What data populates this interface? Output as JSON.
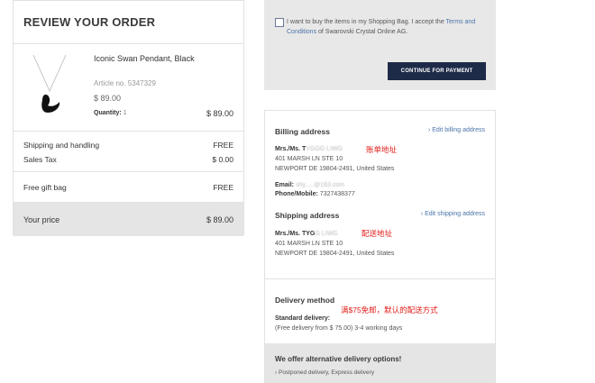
{
  "review": {
    "heading": "REVIEW YOUR ORDER",
    "item": {
      "name": "Iconic Swan Pendant, Black",
      "article": "Article no. 5347329",
      "price": "$ 89.00",
      "qty_label": "Quantity:",
      "qty_value": "1",
      "line_total": "$ 89.00"
    },
    "shipping_label": "Shipping and handling",
    "shipping_value": "FREE",
    "tax_label": "Sales Tax",
    "tax_value": "$ 0.00",
    "gift_label": "Free gift bag",
    "gift_value": "FREE",
    "total_label": "Your price",
    "total_value": "$ 89.00"
  },
  "terms": {
    "text_before": "I want to buy the items in my Shopping Bag. I accept the ",
    "link": "Terms and Conditions",
    "text_after": " of Swarovski Crystal Online AG.",
    "continue_label": "CONTINUE FOR PAYMENT"
  },
  "billing": {
    "heading": "Billing address",
    "edit": "Edit billing address",
    "name_prefix": "Mrs./Ms. T",
    "name_blur": "YGGG LIWG",
    "note": "账单地址",
    "line1": "401 MARSH LN STE 10",
    "line2": "NEWPORT DE 19804-2491, United States",
    "email_label": "Email:",
    "email_blur": "shy.....@163.com",
    "phone_label": "Phone/Mobile:",
    "phone": "7327438377"
  },
  "shipping": {
    "heading": "Shipping address",
    "edit": "Edit shipping address",
    "name_prefix": "Mrs./Ms. TYG",
    "name_blur": "G LIWG",
    "note": "配送地址",
    "line1": "401 MARSH LN STE 10",
    "line2": "NEWPORT DE 19804-2491, United States"
  },
  "delivery": {
    "heading": "Delivery method",
    "note": "满$75免邮，默认的配送方式",
    "method_label": "Standard delivery:",
    "method_desc": "(Free delivery from $ 75.00) 3-4 working days"
  },
  "alternative": {
    "heading": "We offer alternative delivery options!",
    "options": "Postponed delivery, Express delivery"
  },
  "colors": {
    "button_bg": "#1e2b48",
    "link": "#4a74a8",
    "annotation_red": "#e0201b",
    "panel_gray": "#e8e8e8"
  }
}
